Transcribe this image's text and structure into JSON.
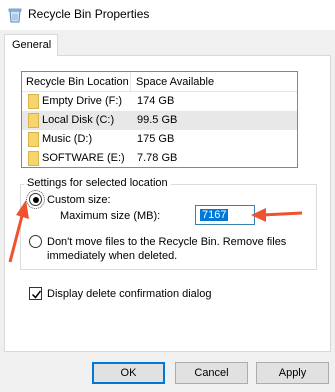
{
  "window": {
    "title": "Recycle Bin Properties",
    "icon": "recycle-bin-icon"
  },
  "tabs": [
    {
      "label": "General"
    }
  ],
  "drive_list": {
    "columns": [
      "Recycle Bin Location",
      "Space Available"
    ],
    "rows": [
      {
        "name": "Empty Drive (F:)",
        "space": "174 GB"
      },
      {
        "name": "Local Disk (C:)",
        "space": "99.5 GB",
        "selected": true
      },
      {
        "name": "Music (D:)",
        "space": "175 GB"
      },
      {
        "name": "SOFTWARE (E:)",
        "space": "7.78 GB"
      }
    ]
  },
  "settings": {
    "group_title": "Settings for selected location",
    "custom_size_label": "Custom size:",
    "custom_size_checked": true,
    "max_size_label": "Maximum size (MB):",
    "max_size_value": "7167",
    "dont_move_line1": "Don't move files to the Recycle Bin. Remove files",
    "dont_move_line2": "immediately when deleted.",
    "dont_move_checked": false
  },
  "confirm": {
    "label": "Display delete confirmation dialog",
    "checked": true
  },
  "buttons": {
    "ok": "OK",
    "cancel": "Cancel",
    "apply": "Apply"
  },
  "colors": {
    "annotation_arrow": "#f0522d",
    "selection": "#0078d7"
  }
}
